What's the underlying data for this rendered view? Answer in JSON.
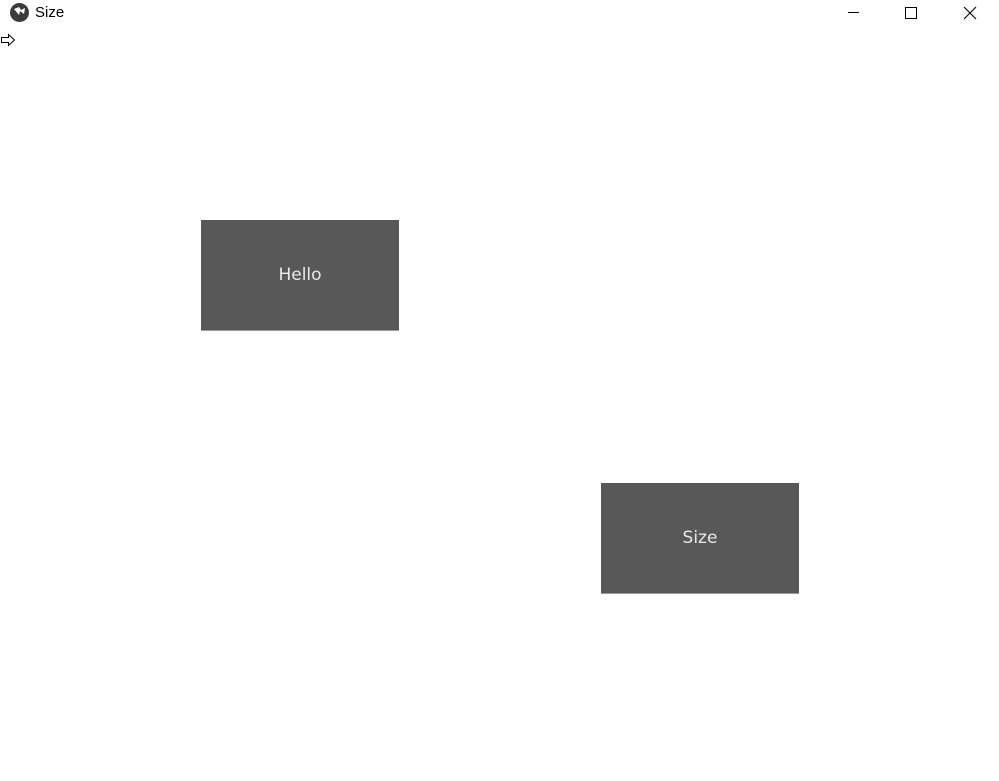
{
  "window": {
    "title": "Size",
    "icon": "kivy-logo-icon",
    "controls": [
      "minimize-icon",
      "maximize-icon",
      "close-icon"
    ]
  },
  "content": {
    "cursor_icon": "pointer-arrow-icon",
    "buttons": [
      {
        "label": "Hello"
      },
      {
        "label": "Size"
      }
    ]
  },
  "colors": {
    "button_bg": "#585858",
    "button_text": "#e8e8e8",
    "background": "#ffffff"
  }
}
